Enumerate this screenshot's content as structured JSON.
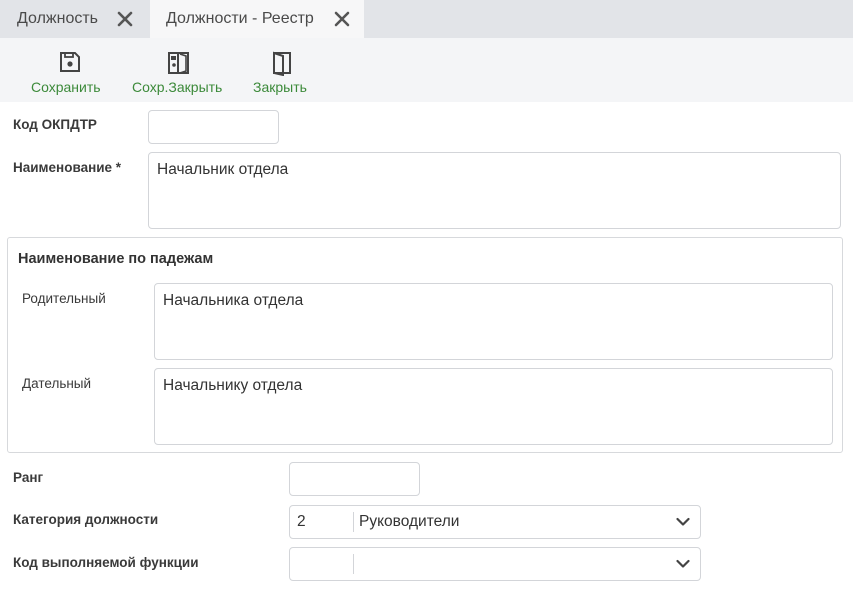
{
  "tabs": [
    {
      "label": "Должность"
    },
    {
      "label": "Должности - Реестр"
    }
  ],
  "toolbar": {
    "save": "Сохранить",
    "save_close": "Сохр.Закрыть",
    "close": "Закрыть"
  },
  "form": {
    "okpdtr": {
      "label": "Код ОКПДТР",
      "value": ""
    },
    "name": {
      "label": "Наименование *",
      "value": "Начальник отдела"
    },
    "cases_group": {
      "title": "Наименование по падежам",
      "genitive": {
        "label": "Родительный",
        "value": "Начальника отдела"
      },
      "dative": {
        "label": "Дательный",
        "value": "Начальнику отдела"
      }
    },
    "rank": {
      "label": "Ранг",
      "value": ""
    },
    "category": {
      "label": "Категория должности",
      "code": "2",
      "value": "Руководители"
    },
    "function_code": {
      "label": "Код выполняемой функции",
      "code": "",
      "value": ""
    }
  },
  "colors": {
    "accent": "#3c8a3a",
    "tab_bg": "#e2e4e8",
    "toolbar_bg": "#f4f5f7",
    "border": "#d3d5d9"
  }
}
